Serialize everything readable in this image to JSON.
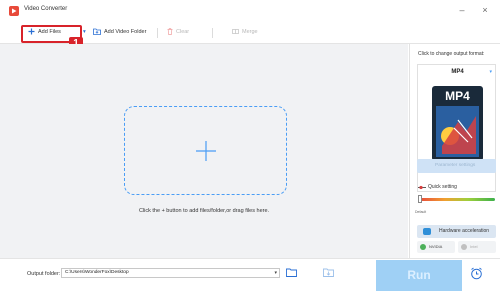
{
  "window": {
    "title": "Video Converter",
    "minimize_icon": "minimize-icon",
    "close_icon": "close-icon"
  },
  "toolbar": {
    "add_files_label": "Add Files",
    "add_video_folder_label": "Add Video Folder",
    "clear_label": "Clear",
    "merge_label": "Merge",
    "badge_number": "1"
  },
  "main": {
    "drop_hint": "Click the + button to add files/folder,or drag files here."
  },
  "right_panel": {
    "output_format_label": "Click to change output format:",
    "format_name": "MP4",
    "format_thumb_text": "MP4",
    "parameter_settings_label": "Parameter settings",
    "quick_setting_label": "Quick setting",
    "slider_default_label": "Default",
    "quality_level": 0,
    "hardware_acceleration_label": "Hardware acceleration",
    "nvidia_label": "NVIDIA",
    "intel_label": "Intel"
  },
  "bottom": {
    "output_folder_label": "Output folder:",
    "output_folder_value": "C:\\Users\\WonderFox\\Desktop",
    "run_label": "Run"
  },
  "colors": {
    "accent": "#4a9df5",
    "highlight": "#d8232a",
    "run_button": "#9fd0f5"
  }
}
